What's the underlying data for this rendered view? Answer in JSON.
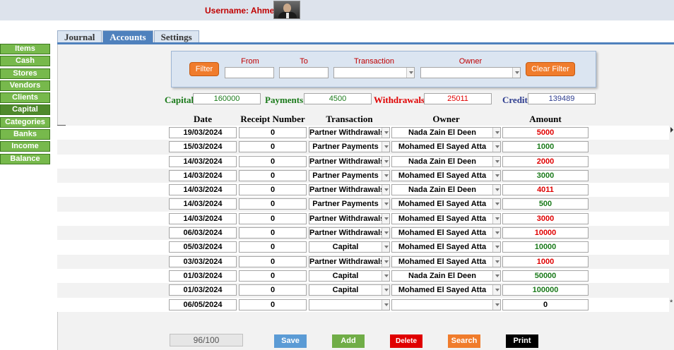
{
  "header": {
    "username_text": "Username: Ahmed"
  },
  "sidebar": {
    "items": [
      "Items",
      "Cash",
      "Stores",
      "Vendors",
      "Clients",
      "Capital",
      "Categories",
      "Banks",
      "Income",
      "Balance"
    ],
    "active": "Capital"
  },
  "tabs": [
    "Journal",
    "Accounts",
    "Settings"
  ],
  "filter": {
    "filter_label": "Filter",
    "from_label": "From",
    "to_label": "To",
    "transaction_label": "Transaction",
    "owner_label": "Owner",
    "clear_label": "Clear Filter",
    "from_value": "",
    "to_value": "",
    "transaction_value": "",
    "owner_value": ""
  },
  "summary": {
    "capital_label": "Capital",
    "capital_value": "160000",
    "payments_label": "Payments",
    "payments_value": "4500",
    "withdrawals_label": "Withdrawals",
    "withdrawals_value": "25011",
    "credit_label": "Credit",
    "credit_value": "139489"
  },
  "table": {
    "headers": {
      "date": "Date",
      "receipt": "Receipt Number",
      "transaction": "Transaction",
      "owner": "Owner",
      "amount": "Amount"
    },
    "rows": [
      {
        "date": "19/03/2024",
        "receipt": "0",
        "transaction": "Partner Withdrawals",
        "owner": "Nada Zain El Deen",
        "amount": "5000",
        "color": "#e00000"
      },
      {
        "date": "15/03/2024",
        "receipt": "0",
        "transaction": "Partner Payments",
        "owner": "Mohamed El Sayed Atta",
        "amount": "1000",
        "color": "#1a7a1a"
      },
      {
        "date": "14/03/2024",
        "receipt": "0",
        "transaction": "Partner Withdrawals",
        "owner": "Nada Zain El Deen",
        "amount": "2000",
        "color": "#e00000"
      },
      {
        "date": "14/03/2024",
        "receipt": "0",
        "transaction": "Partner Payments",
        "owner": "Mohamed El Sayed Atta",
        "amount": "3000",
        "color": "#1a7a1a"
      },
      {
        "date": "14/03/2024",
        "receipt": "0",
        "transaction": "Partner Withdrawals",
        "owner": "Nada Zain El Deen",
        "amount": "4011",
        "color": "#e00000"
      },
      {
        "date": "14/03/2024",
        "receipt": "0",
        "transaction": "Partner Payments",
        "owner": "Mohamed El Sayed Atta",
        "amount": "500",
        "color": "#1a7a1a"
      },
      {
        "date": "14/03/2024",
        "receipt": "0",
        "transaction": "Partner Withdrawals",
        "owner": "Mohamed El Sayed Atta",
        "amount": "3000",
        "color": "#e00000"
      },
      {
        "date": "06/03/2024",
        "receipt": "0",
        "transaction": "Partner Withdrawals",
        "owner": "Mohamed El Sayed Atta",
        "amount": "10000",
        "color": "#e00000"
      },
      {
        "date": "05/03/2024",
        "receipt": "0",
        "transaction": "Capital",
        "owner": "Mohamed El Sayed Atta",
        "amount": "10000",
        "color": "#1a7a1a"
      },
      {
        "date": "03/03/2024",
        "receipt": "0",
        "transaction": "Partner Withdrawals",
        "owner": "Mohamed El Sayed Atta",
        "amount": "1000",
        "color": "#e00000"
      },
      {
        "date": "01/03/2024",
        "receipt": "0",
        "transaction": "Capital",
        "owner": "Nada Zain El Deen",
        "amount": "50000",
        "color": "#1a7a1a"
      },
      {
        "date": "01/03/2024",
        "receipt": "0",
        "transaction": "Capital",
        "owner": "Mohamed El Sayed Atta",
        "amount": "100000",
        "color": "#1a7a1a"
      },
      {
        "date": "06/05/2024",
        "receipt": "0",
        "transaction": "",
        "owner": "",
        "amount": "0",
        "color": "#000000"
      }
    ]
  },
  "footer": {
    "record_counter": "96/100",
    "save_label": "Save",
    "add_label": "Add",
    "delete_label": "Delete",
    "search_label": "Search",
    "print_label": "Print"
  },
  "colors": {
    "tab_active": "#4f81bd",
    "sidebar_green": "#77b94c",
    "accent_red": "#c00000",
    "orange": "#f07c2c",
    "save_blue": "#5b9bd5",
    "add_green": "#70ad47",
    "delete_red": "#e00000",
    "print_black": "#000000"
  }
}
